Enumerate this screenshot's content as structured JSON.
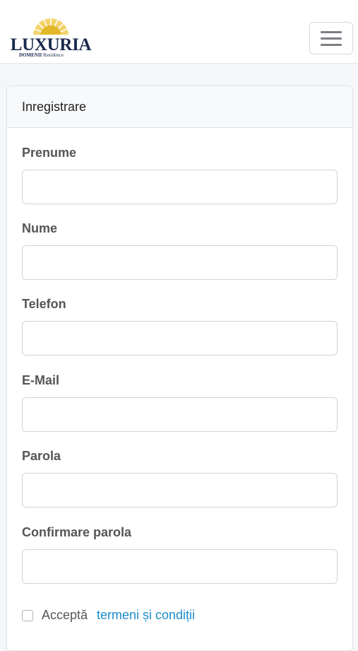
{
  "header": {
    "logo_text": "LUXURIA",
    "logo_sub_bold": "DOMENII",
    "logo_sub": "Residence",
    "menu_icon": "hamburger-menu-icon"
  },
  "form": {
    "title": "Inregistrare",
    "fields": [
      {
        "label": "Prenume",
        "value": "",
        "placeholder": ""
      },
      {
        "label": "Nume",
        "value": "",
        "placeholder": ""
      },
      {
        "label": "Telefon",
        "value": "",
        "placeholder": ""
      },
      {
        "label": "E-Mail",
        "value": "",
        "placeholder": ""
      },
      {
        "label": "Parola",
        "value": "",
        "placeholder": ""
      },
      {
        "label": "Confirmare parola",
        "value": "",
        "placeholder": ""
      }
    ],
    "terms": {
      "checked": false,
      "text": "Acceptă",
      "link": "termeni și condiții"
    }
  },
  "colors": {
    "brand_navy": "#1a2a4e",
    "brand_gold": "#e2b72a",
    "link": "#1a8ccc"
  }
}
